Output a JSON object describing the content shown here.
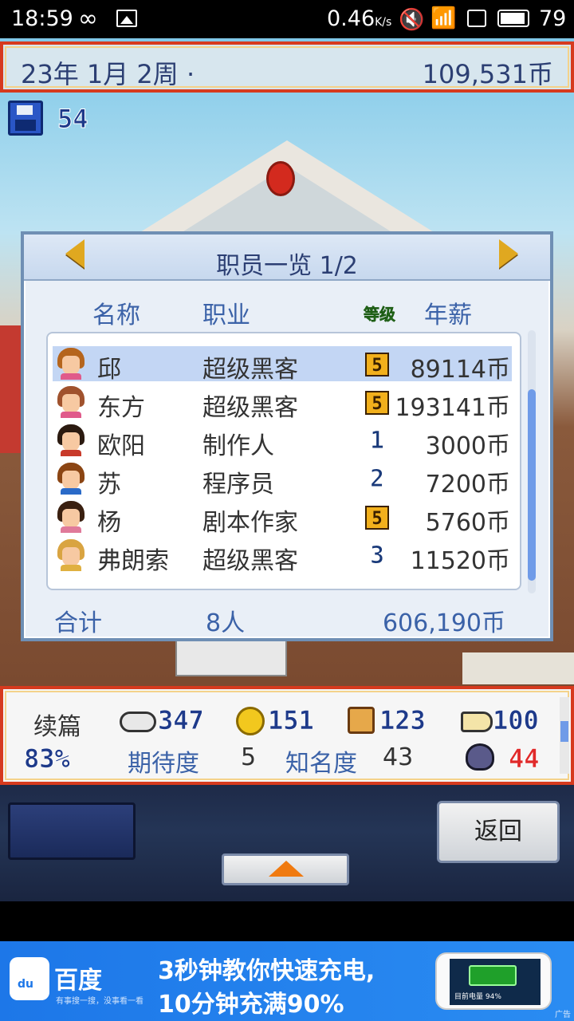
{
  "status_bar": {
    "time": "18:59",
    "speed": "0.46",
    "speed_unit": "K/s",
    "battery": "79"
  },
  "top_bar": {
    "date": "23年 1月 2周 ·",
    "money": "109,531币"
  },
  "save": {
    "count": "54"
  },
  "dialog": {
    "title": "职员一览 1/2",
    "headers": {
      "name": "名称",
      "job": "职业",
      "level": "等级",
      "salary": "年薪"
    },
    "rows": [
      {
        "name": "邱",
        "job": "超级黑客",
        "level": "5",
        "salary": "89114币",
        "hair": "#b5651d",
        "shirt": "#e05a8a"
      },
      {
        "name": "东方",
        "job": "超级黑客",
        "level": "5",
        "salary": "193141币",
        "hair": "#a0522d",
        "shirt": "#e05a8a"
      },
      {
        "name": "欧阳",
        "job": "制作人",
        "level": "1",
        "salary": "3000币",
        "hair": "#2b1a10",
        "shirt": "#c83a2a"
      },
      {
        "name": "苏",
        "job": "程序员",
        "level": "2",
        "salary": "7200币",
        "hair": "#8b4513",
        "shirt": "#2a6ac8"
      },
      {
        "name": "杨",
        "job": "剧本作家",
        "level": "5",
        "salary": "5760币",
        "hair": "#3a2010",
        "shirt": "#e07a9a"
      },
      {
        "name": "弗朗索",
        "job": "超级黑客",
        "level": "3",
        "salary": "11520币",
        "hair": "#d9a441",
        "shirt": "#e0b040"
      }
    ],
    "total_label": "合计",
    "total_count": "8人",
    "total_salary": "606,190币"
  },
  "stats": {
    "sequel_label": "续篇",
    "fun": "347",
    "coins": "151",
    "graphics": "123",
    "sound": "100",
    "percent": "83%",
    "expect_label": "期待度",
    "expect_value": "5",
    "fame_label": "知名度",
    "fame_value": "43",
    "bugs": "44"
  },
  "controls": {
    "back_label": "返回"
  },
  "ad": {
    "brand": "百度",
    "slogan": "有事搜一搜，没事看一看",
    "line1": "3秒钟教你快速充电,",
    "line2": "10分钟充满90%",
    "phone_text": "目前电量 94%",
    "tag": "广告"
  },
  "colors": {
    "accent_frame": "#d63a1e",
    "dialog_text": "#3b62a8",
    "stat_blue": "#1e3a8a",
    "bug_red": "#e02a2a"
  }
}
